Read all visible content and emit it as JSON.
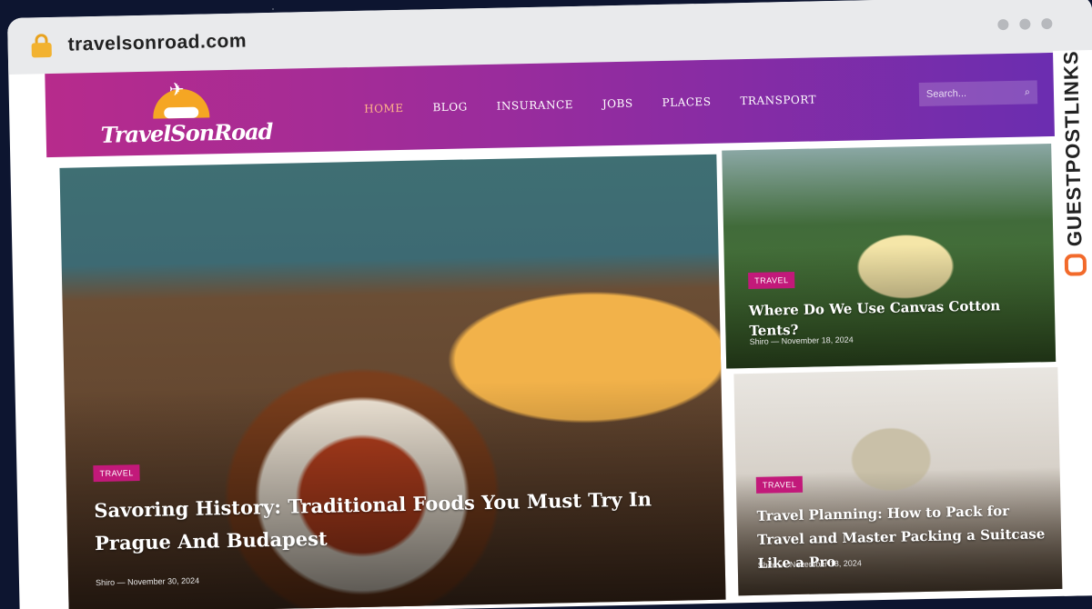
{
  "browser": {
    "url": "travelsonroad.com"
  },
  "site": {
    "logo_text": "TravelSonRoad",
    "nav": [
      "HOME",
      "BLOG",
      "INSURANCE",
      "JOBS",
      "PLACES",
      "TRANSPORT"
    ],
    "search_placeholder": "Search..."
  },
  "posts": [
    {
      "category": "TRAVEL",
      "title": "Savoring History: Traditional Foods You Must Try In Prague And Budapest",
      "author": "Shiro",
      "date": "November 30, 2024"
    },
    {
      "category": "TRAVEL",
      "title": "Where Do We Use Canvas Cotton Tents?",
      "author": "Shiro",
      "date": "November 18, 2024"
    },
    {
      "category": "TRAVEL",
      "title": "Travel Planning: How to Pack for Travel and Master Packing a Suitcase Like a Pro",
      "author": "Shiro",
      "date": "November 18, 2024"
    }
  ],
  "watermark": {
    "text": "GUESTPOSTLINKS"
  },
  "colors": {
    "header_start": "#b72b8c",
    "header_end": "#6b2db0",
    "tag": "#c2197a",
    "nav_active": "#ffb48a"
  }
}
